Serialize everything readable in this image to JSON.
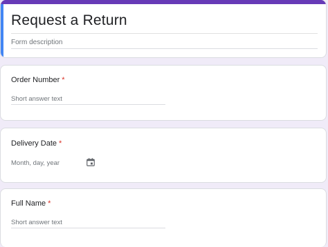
{
  "form": {
    "title": "Request a Return",
    "description_placeholder": "Form description",
    "theme_color": "#673ab7",
    "accent_color": "#4285f4",
    "background_color": "#f0ebf8"
  },
  "questions": [
    {
      "label": "Order Number",
      "required_marker": "*",
      "input_placeholder": "Short answer text"
    },
    {
      "label": "Delivery Date",
      "required_marker": "*",
      "input_placeholder": "Month, day, year",
      "icon": "calendar-icon"
    },
    {
      "label": "Full Name",
      "required_marker": "*",
      "input_placeholder": "Short answer text"
    }
  ]
}
